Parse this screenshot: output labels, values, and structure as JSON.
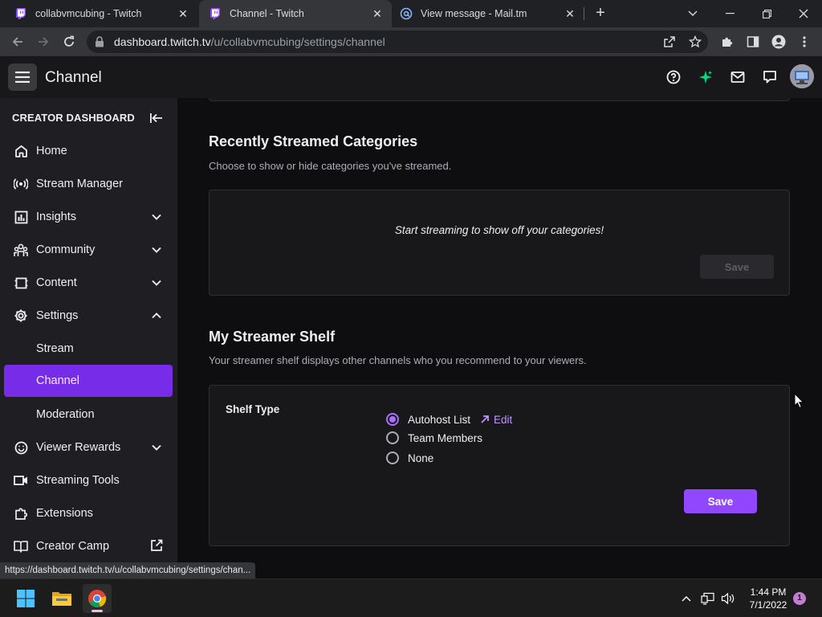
{
  "browser": {
    "tabs": [
      {
        "title": "collabvmcubing - Twitch",
        "active": false
      },
      {
        "title": "Channel - Twitch",
        "active": true
      },
      {
        "title": "View message - Mail.tm",
        "active": false
      }
    ],
    "url_host": "dashboard.twitch.tv",
    "url_path": "/u/collabvmcubing/settings/channel",
    "status_url": "https://dashboard.twitch.tv/u/collabvmcubing/settings/chan..."
  },
  "topnav": {
    "title": "Channel"
  },
  "sidebar": {
    "header": "CREATOR DASHBOARD",
    "items": [
      {
        "label": "Home",
        "icon": "home-icon"
      },
      {
        "label": "Stream Manager",
        "icon": "broadcast-icon"
      },
      {
        "label": "Insights",
        "icon": "chart-icon",
        "expandable": true
      },
      {
        "label": "Community",
        "icon": "community-icon",
        "expandable": true
      },
      {
        "label": "Content",
        "icon": "content-icon",
        "expandable": true
      },
      {
        "label": "Settings",
        "icon": "gear-icon",
        "expanded": true
      },
      {
        "label": "Stream",
        "sub": true
      },
      {
        "label": "Channel",
        "sub": true,
        "active": true
      },
      {
        "label": "Moderation",
        "sub": true
      },
      {
        "label": "Viewer Rewards",
        "icon": "rewards-icon",
        "expandable": true
      },
      {
        "label": "Streaming Tools",
        "icon": "camera-icon"
      },
      {
        "label": "Extensions",
        "icon": "puzzle-icon"
      },
      {
        "label": "Creator Camp",
        "icon": "book-icon",
        "external": true
      }
    ]
  },
  "categories": {
    "title": "Recently Streamed Categories",
    "description": "Choose to show or hide categories you've streamed.",
    "empty_message": "Start streaming to show off your categories!",
    "save_label": "Save"
  },
  "shelf": {
    "title": "My Streamer Shelf",
    "description": "Your streamer shelf displays other channels who you recommend to your viewers.",
    "type_label": "Shelf Type",
    "options": [
      {
        "label": "Autohost List",
        "checked": true
      },
      {
        "label": "Team Members",
        "checked": false
      },
      {
        "label": "None",
        "checked": false
      }
    ],
    "edit_label": "Edit",
    "save_label": "Save"
  },
  "taskbar": {
    "time": "1:44 PM",
    "date": "7/1/2022",
    "notification_count": "1"
  },
  "colors": {
    "accent": "#9147ff",
    "active_nav": "#772ce8",
    "link": "#bf94ff",
    "background": "#0e0e10",
    "card": "#18181b"
  }
}
